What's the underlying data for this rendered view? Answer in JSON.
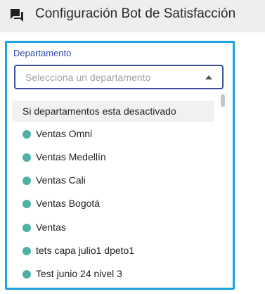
{
  "header": {
    "title": "Configuración Bot de Satisfacción",
    "icon": "forum-chat-icon"
  },
  "department_field": {
    "label": "Departamento",
    "placeholder": "Selecciona un departamento",
    "dropdown_icon": "caret-up-icon",
    "accent_color": "#1aa3dc",
    "label_color": "#2f4bb0"
  },
  "dropdown": {
    "header_option": "Si departamentos esta desactivado",
    "items": [
      {
        "label": "Ventas Omni",
        "status_color": "#4fb0a8"
      },
      {
        "label": "Ventas Medellín",
        "status_color": "#4fb0a8"
      },
      {
        "label": "Ventas Cali",
        "status_color": "#4fb0a8"
      },
      {
        "label": "Ventas Bogotá",
        "status_color": "#4fb0a8"
      },
      {
        "label": "Ventas",
        "status_color": "#4fb0a8"
      },
      {
        "label": "tets capa julio1 dpeto1",
        "status_color": "#4fb0a8"
      },
      {
        "label": "Test junio 24 nivel 3",
        "status_color": "#4fb0a8"
      }
    ]
  }
}
